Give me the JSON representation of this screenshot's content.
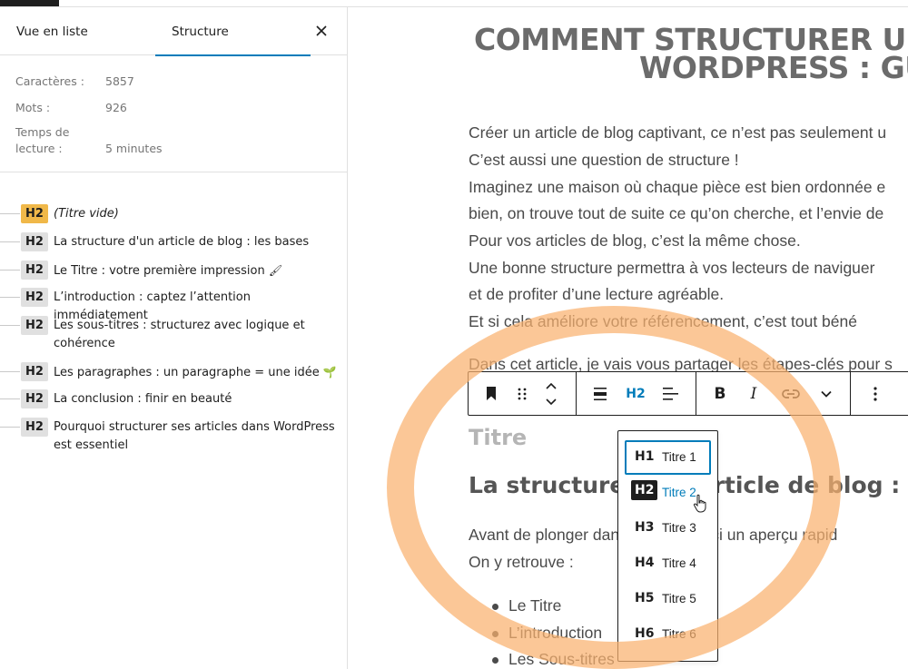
{
  "sidebar": {
    "tabs": [
      {
        "label": "Vue en liste"
      },
      {
        "label": "Structure"
      }
    ],
    "stats": [
      {
        "label": "Caractères :",
        "value": "5857"
      },
      {
        "label": "Mots :",
        "value": "926"
      },
      {
        "label_line1": "Temps de",
        "label_line2": "lecture :",
        "value": "5 minutes"
      }
    ],
    "outline": [
      {
        "level": "H2",
        "text": "(Titre vide)",
        "warning": true
      },
      {
        "level": "H2",
        "text": "La structure d'un article de blog : les bases"
      },
      {
        "level": "H2",
        "text": "Le Titre : votre première impression",
        "emoji": "🖌"
      },
      {
        "level": "H2",
        "text": "L’introduction : captez l’attention immédiatement"
      },
      {
        "level": "H2",
        "text": "Les sous-titres : structurez avec logique et cohérence"
      },
      {
        "level": "H2",
        "text": "Les paragraphes : un paragraphe = une idée",
        "emoji": "🌱"
      },
      {
        "level": "H2",
        "text": "La conclusion : finir en beauté"
      },
      {
        "level": "H2",
        "text": "Pourquoi structurer ses articles dans WordPress est essentiel"
      }
    ]
  },
  "editor": {
    "title_line1": "COMMENT STRUCTURER UN",
    "title_line2": "WORDPRESS : GU",
    "paragraphs": [
      "Créer un article de blog captivant, ce n’est pas seulement u",
      "C’est aussi une question de structure !",
      "Imaginez une maison où chaque pièce est bien ordonnée e",
      "bien, on trouve tout de suite ce qu’on cherche, et l’envie de",
      "Pour vos articles de blog, c’est la même chose.",
      "Une bonne structure permettra à vos lecteurs de naviguer",
      "et de profiter d’une lecture agréable.",
      "Et si cela améliore votre référencement, c’est tout béné",
      "Dans cet article, je vais vous partager les étapes-clés pour s"
    ],
    "heading_placeholder": "Titre",
    "heading_h2": "La structure d’un article de blog : les",
    "after_heading": [
      "Avant de plonger dans le sujet, voici un aperçu rapid",
      "On y retrouve :"
    ],
    "bullets": [
      "Le Titre",
      "L’introduction",
      "Les Sous-titres"
    ]
  },
  "toolbar": {
    "heading_level": "H2",
    "bold_label": "B",
    "italic_label": "I"
  },
  "heading_dropdown": {
    "items": [
      {
        "icon": "H1",
        "label": "Titre 1"
      },
      {
        "icon": "H2",
        "label": "Titre 2"
      },
      {
        "icon": "H3",
        "label": "Titre 3"
      },
      {
        "icon": "H4",
        "label": "Titre 4"
      },
      {
        "icon": "H5",
        "label": "Titre 5"
      },
      {
        "icon": "H6",
        "label": "Titre 6"
      }
    ],
    "selected": "H2",
    "focused": "H1"
  },
  "colors": {
    "accent": "#007cba",
    "warning_badge": "#f0b849",
    "annotation_ring": "#f9b16f",
    "title_gray": "#6b6b6b"
  }
}
